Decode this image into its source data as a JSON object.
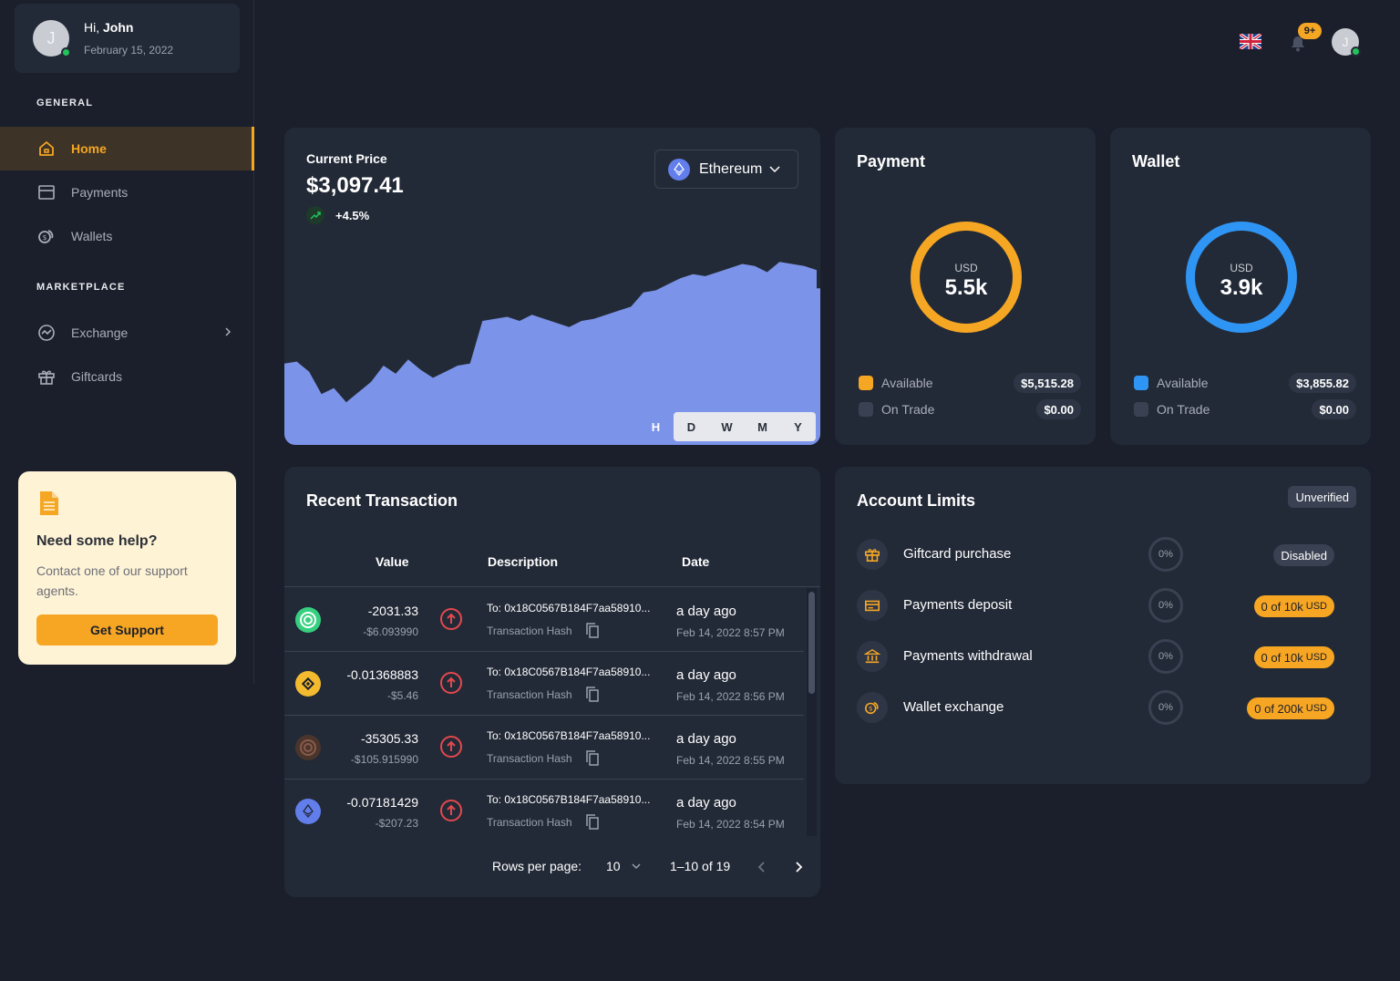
{
  "user": {
    "greeting": "Hi,",
    "name": "John",
    "date": "February 15, 2022",
    "initial": "J"
  },
  "sidebar": {
    "general_title": "GENERAL",
    "marketplace_title": "MARKETPLACE",
    "items": [
      {
        "label": "Home"
      },
      {
        "label": "Payments"
      },
      {
        "label": "Wallets"
      },
      {
        "label": "Exchange"
      },
      {
        "label": "Giftcards"
      }
    ]
  },
  "help": {
    "title": "Need some help?",
    "text": "Contact one of our support agents.",
    "button": "Get Support"
  },
  "topbar": {
    "notification_badge": "9+"
  },
  "price": {
    "label": "Current Price",
    "value": "$3,097.41",
    "change": "+4.5%",
    "coin": "Ethereum",
    "ranges": [
      "H",
      "D",
      "W",
      "M",
      "Y"
    ]
  },
  "chart_data": {
    "type": "area",
    "color": "#7b93e8",
    "values": [
      0.4,
      0.41,
      0.36,
      0.25,
      0.28,
      0.21,
      0.26,
      0.31,
      0.39,
      0.35,
      0.42,
      0.37,
      0.33,
      0.36,
      0.39,
      0.4,
      0.61,
      0.62,
      0.63,
      0.61,
      0.64,
      0.62,
      0.6,
      0.58,
      0.61,
      0.62,
      0.64,
      0.66,
      0.68,
      0.75,
      0.76,
      0.79,
      0.82,
      0.84,
      0.83,
      0.85,
      0.87,
      0.89,
      0.88,
      0.85,
      0.9,
      0.89,
      0.88,
      0.86
    ],
    "title": "",
    "xlabel": "",
    "ylabel": ""
  },
  "payment": {
    "title": "Payment",
    "currency": "USD",
    "total": "5.5k",
    "ring_color": "#f5a623",
    "legend": [
      {
        "label": "Available",
        "amount": "$5,515.28",
        "color": "#f5a623"
      },
      {
        "label": "On Trade",
        "amount": "$0.00",
        "color": "#3a4152"
      }
    ]
  },
  "wallet": {
    "title": "Wallet",
    "currency": "USD",
    "total": "3.9k",
    "ring_color": "#2f95f5",
    "legend": [
      {
        "label": "Available",
        "amount": "$3,855.82",
        "color": "#2f95f5"
      },
      {
        "label": "On Trade",
        "amount": "$0.00",
        "color": "#3a4152"
      }
    ]
  },
  "transactions": {
    "title": "Recent Transaction",
    "headers": {
      "value": "Value",
      "description": "Description",
      "date": "Date"
    },
    "rows": [
      {
        "coin": "celo-icon",
        "color": "#35d07f",
        "value": "-2031.33",
        "usd": "-$6.093990",
        "to": "To: 0x18C0567B184F7aa58910...",
        "hash": "Transaction Hash",
        "ago": "a day ago",
        "date": "Feb 14, 2022 8:57 PM"
      },
      {
        "coin": "binance-icon",
        "color": "#f3ba2f",
        "value": "-0.01368883",
        "usd": "-$5.46",
        "to": "To: 0x18C0567B184F7aa58910...",
        "hash": "Transaction Hash",
        "ago": "a day ago",
        "date": "Feb 14, 2022 8:56 PM"
      },
      {
        "coin": "celo-dollar-icon",
        "color": "#6b4b3e",
        "value": "-35305.33",
        "usd": "-$105.915990",
        "to": "To: 0x18C0567B184F7aa58910...",
        "hash": "Transaction Hash",
        "ago": "a day ago",
        "date": "Feb 14, 2022 8:55 PM"
      },
      {
        "coin": "ethereum-icon",
        "color": "#627eea",
        "value": "-0.07181429",
        "usd": "-$207.23",
        "to": "To: 0x18C0567B184F7aa58910...",
        "hash": "Transaction Hash",
        "ago": "a day ago",
        "date": "Feb 14, 2022 8:54 PM"
      }
    ],
    "pagination": {
      "rows_label": "Rows per page:",
      "rows_value": "10",
      "range": "1–10 of 19"
    }
  },
  "limits": {
    "title": "Account Limits",
    "status": "Unverified",
    "items": [
      {
        "name": "Giftcard purchase",
        "percent": "0%",
        "badge": "Disabled",
        "unit": ""
      },
      {
        "name": "Payments deposit",
        "percent": "0%",
        "badge": "0 of 10k",
        "unit": "USD"
      },
      {
        "name": "Payments withdrawal",
        "percent": "0%",
        "badge": "0 of 10k",
        "unit": "USD"
      },
      {
        "name": "Wallet exchange",
        "percent": "0%",
        "badge": "0 of 200k",
        "unit": "USD"
      }
    ]
  }
}
